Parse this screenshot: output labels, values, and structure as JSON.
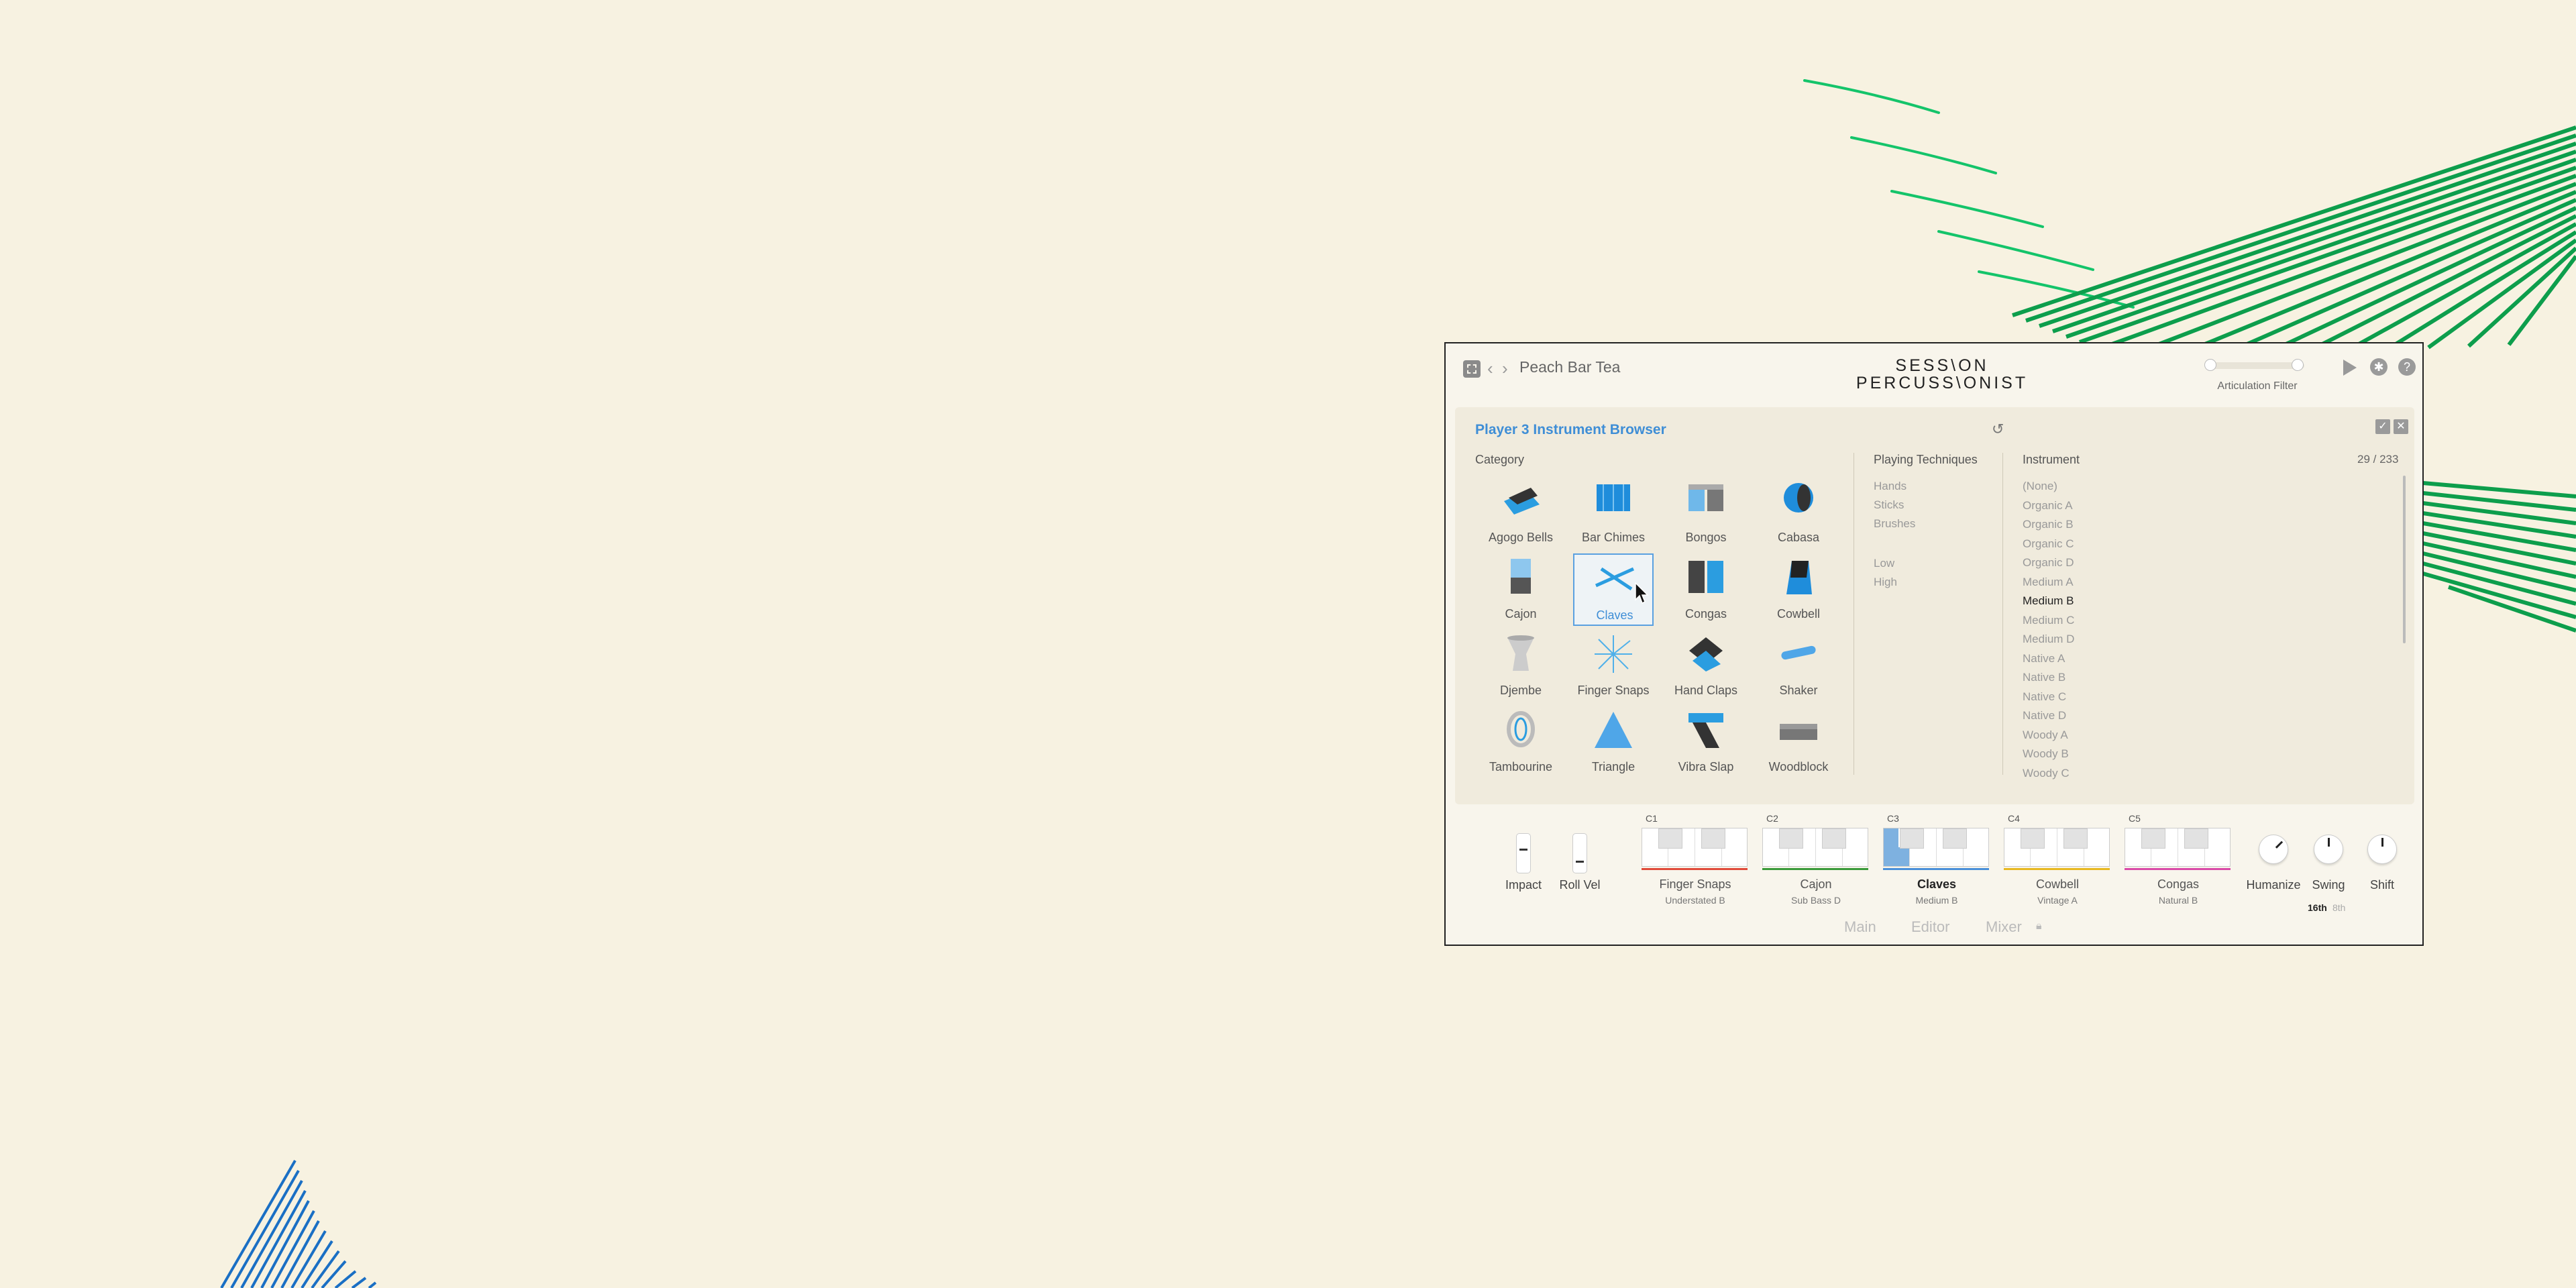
{
  "plugin": {
    "preset_name": "Peach Bar Tea",
    "brand_line1": "SESS\\ON",
    "brand_line2": "PERCUSS\\ONIST",
    "articulation_filter_label": "Articulation Filter"
  },
  "browser": {
    "title": "Player 3 Instrument Browser",
    "category_heading": "Category",
    "techniques_heading": "Playing Techniques",
    "instrument_heading": "Instrument",
    "count": "29 / 233",
    "categories": [
      {
        "label": "Agogo Bells"
      },
      {
        "label": "Bar Chimes"
      },
      {
        "label": "Bongos"
      },
      {
        "label": "Cabasa"
      },
      {
        "label": "Cajon"
      },
      {
        "label": "Claves"
      },
      {
        "label": "Congas"
      },
      {
        "label": "Cowbell"
      },
      {
        "label": "Djembe"
      },
      {
        "label": "Finger Snaps"
      },
      {
        "label": "Hand Claps"
      },
      {
        "label": "Shaker"
      },
      {
        "label": "Tambourine"
      },
      {
        "label": "Triangle"
      },
      {
        "label": "Vibra Slap"
      },
      {
        "label": "Woodblock"
      }
    ],
    "selected_category": "Claves",
    "techniques": [
      "Hands",
      "Sticks",
      "Brushes"
    ],
    "pitches": [
      "Low",
      "High"
    ],
    "instruments": [
      "(None)",
      "Organic A",
      "Organic B",
      "Organic C",
      "Organic D",
      "Medium A",
      "Medium B",
      "Medium C",
      "Medium D",
      "Native A",
      "Native B",
      "Native C",
      "Native D",
      "Woody A",
      "Woody B",
      "Woody C"
    ],
    "selected_instrument": "Medium B"
  },
  "controls": {
    "impact_label": "Impact",
    "roll_vel_label": "Roll Vel",
    "humanize_label": "Humanize",
    "swing_label": "Swing",
    "shift_label": "Shift",
    "swing_options": [
      "16th",
      "8th"
    ]
  },
  "slots": [
    {
      "note": "C1",
      "name": "Finger Snaps",
      "sub": "Understated B",
      "color": "#e04a3a"
    },
    {
      "note": "C2",
      "name": "Cajon",
      "sub": "Sub Bass D",
      "color": "#3a9a3a"
    },
    {
      "note": "C3",
      "name": "Claves",
      "sub": "Medium B",
      "color": "#4a90d9"
    },
    {
      "note": "C4",
      "name": "Cowbell",
      "sub": "Vintage A",
      "color": "#e8b820"
    },
    {
      "note": "C5",
      "name": "Congas",
      "sub": "Natural B",
      "color": "#d94aa8"
    }
  ],
  "tabs": [
    "Main",
    "Editor",
    "Mixer"
  ],
  "colors": {
    "accent": "#3f8ed6",
    "background": "#f7f2e1",
    "bg_art_green": "#0fa855",
    "bg_art_blue": "#1a6fc4"
  }
}
